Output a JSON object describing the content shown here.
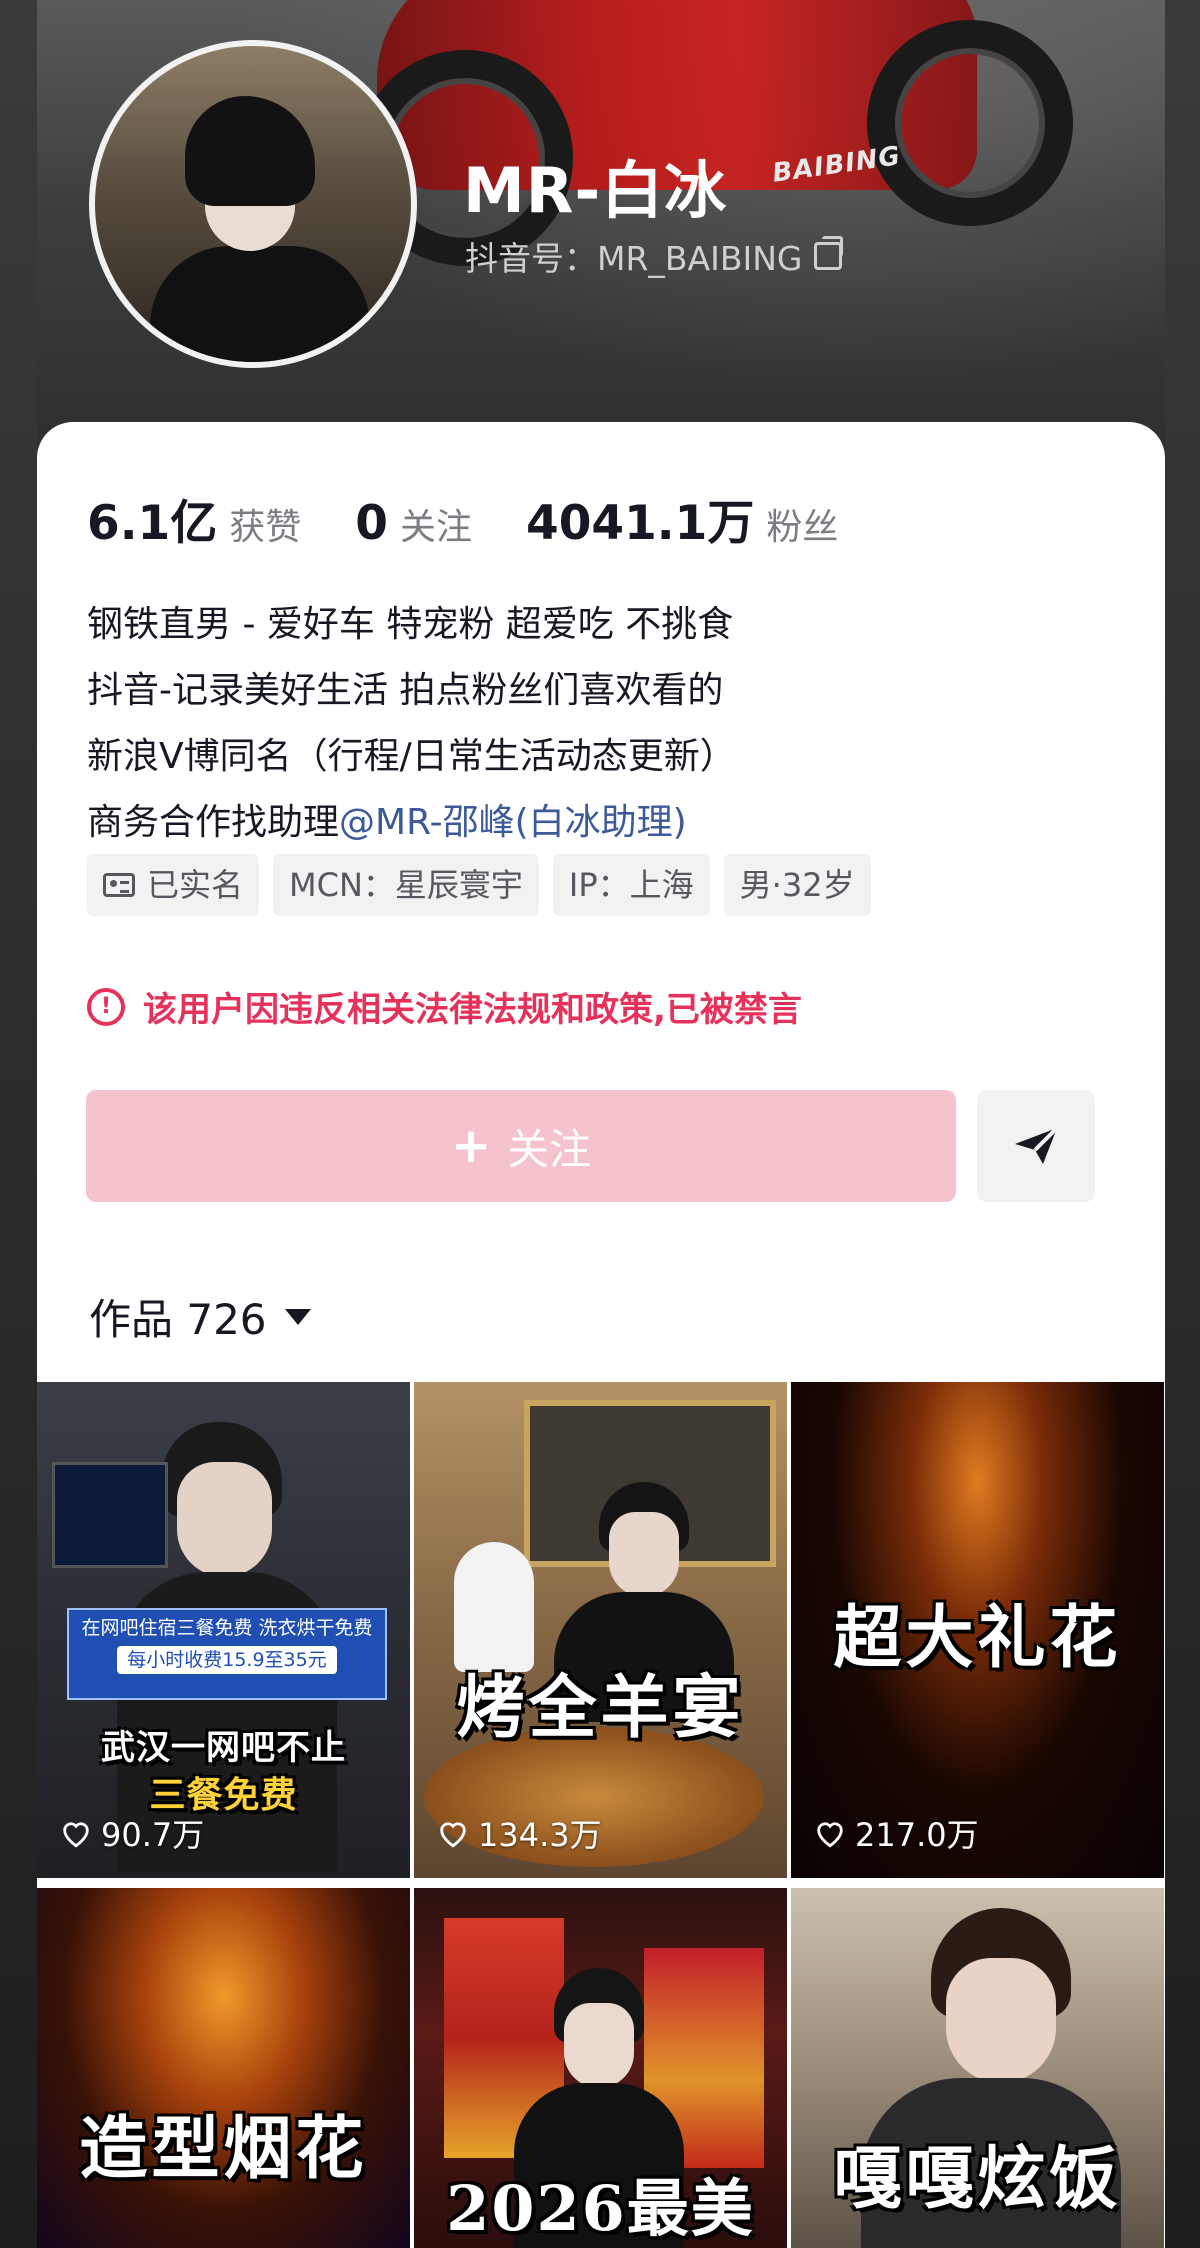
{
  "profile": {
    "name": "MR-白冰",
    "douyin_id": "抖音号：MR_BAIBING",
    "header_bike_brand": "BAIBING"
  },
  "stats": [
    {
      "value": "6.1亿",
      "label": "获赞"
    },
    {
      "value": "0",
      "label": "关注"
    },
    {
      "value": "4041.1万",
      "label": "粉丝"
    }
  ],
  "bio": {
    "lines": [
      "钢铁直男 - 爱好车 特宠粉 超爱吃 不挑食",
      "抖音-记录美好生活 拍点粉丝们喜欢看的",
      "新浪V博同名（行程/日常生活动态更新）"
    ],
    "contact_prefix": "商务合作找助理",
    "contact_mention": "@MR-邵峰(白冰助理)"
  },
  "tags": [
    "已实名",
    "MCN：星辰寰宇",
    "IP：上海",
    "男·32岁"
  ],
  "warning": "该用户因违反相关法律法规和政策,已被禁言",
  "actions": {
    "follow_label": "关注",
    "follow_plus": "+"
  },
  "works": {
    "label": "作品 726"
  },
  "videos": [
    {
      "caption": "武汉一网吧不止",
      "caption2": "三餐免费",
      "banner": "在网吧住宿三餐免费 洗衣烘干免费",
      "banner_price": "每小时收费15.9至35元",
      "likes": "90.7万"
    },
    {
      "caption": "烤全羊宴",
      "likes": "134.3万"
    },
    {
      "caption": "超大礼花",
      "likes": "217.0万"
    },
    {
      "caption": "造型烟花"
    },
    {
      "caption": "2026最美"
    },
    {
      "caption": "嘎嘎炫饭"
    }
  ],
  "colors": {
    "accent_red": "#e6325a",
    "follow_disabled": "#f4c3cc",
    "mention_blue": "#3c5a99"
  }
}
